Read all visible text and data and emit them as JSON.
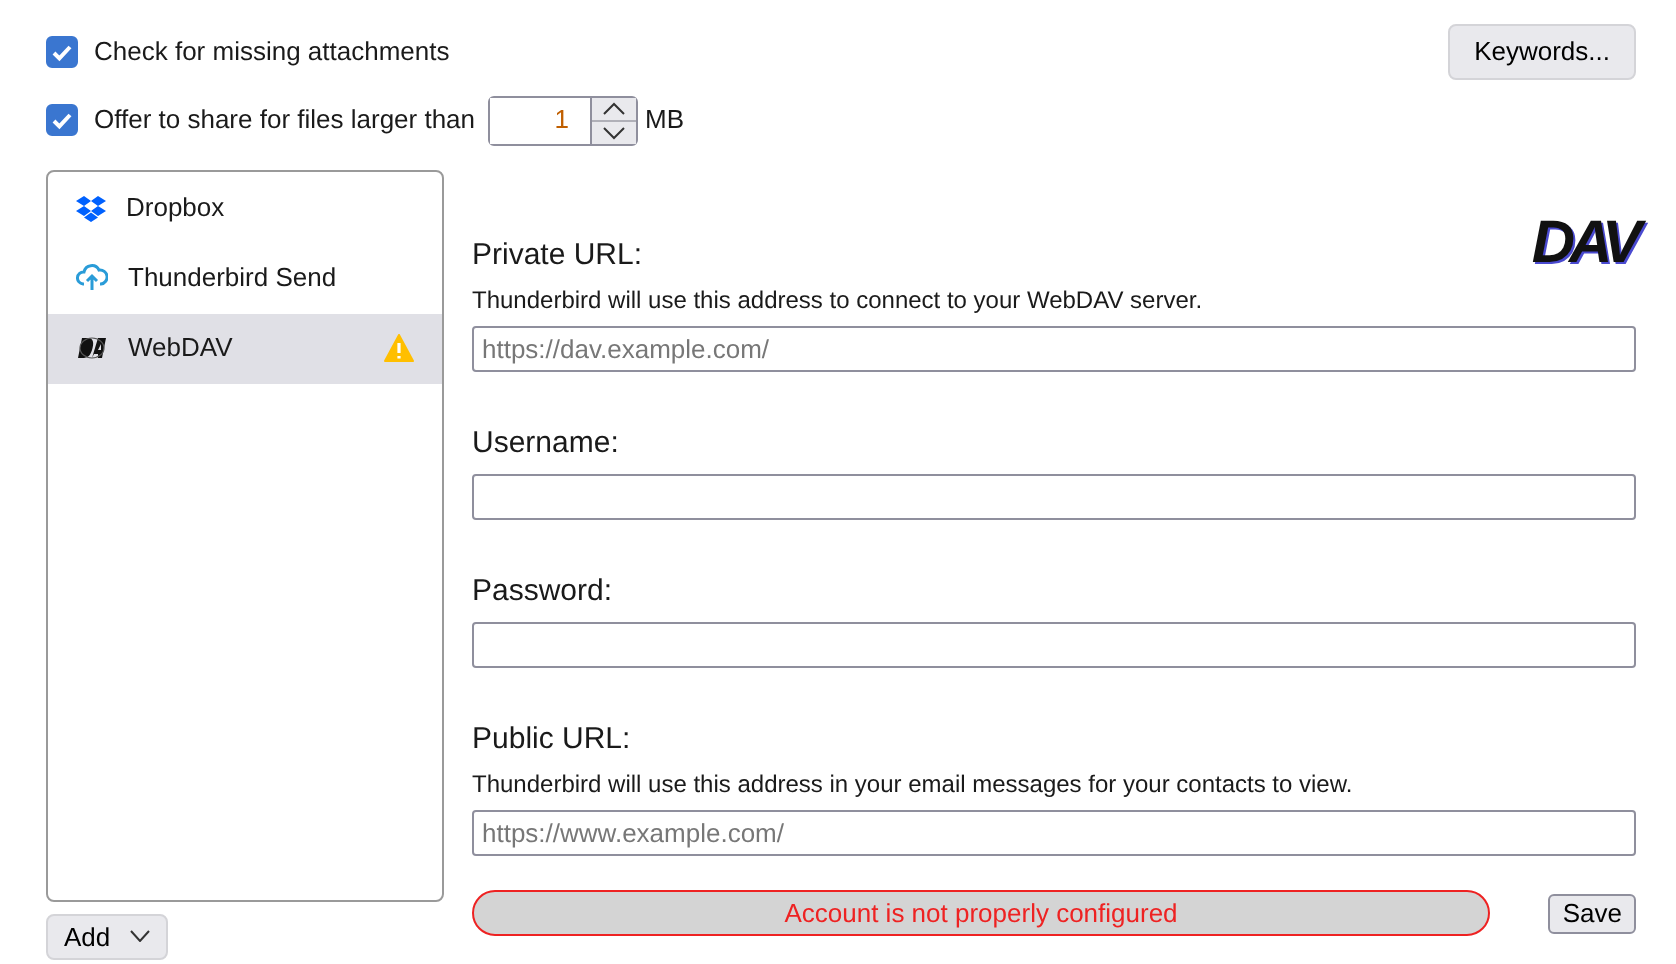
{
  "options": [
    {
      "label": "Check for missing attachments",
      "checked": true
    },
    {
      "label": "Offer to share for files larger than",
      "checked": true,
      "value": "1",
      "unit": "MB"
    }
  ],
  "keywords_button": "Keywords...",
  "providers": [
    {
      "name": "Dropbox",
      "selected": false,
      "warning": false
    },
    {
      "name": "Thunderbird Send",
      "selected": false,
      "warning": false
    },
    {
      "name": "WebDAV",
      "selected": true,
      "warning": true
    }
  ],
  "add_button": "Add",
  "form": {
    "logo": "DAV",
    "fields": [
      {
        "label": "Private URL:",
        "description": "Thunderbird will use this address to connect to your WebDAV server.",
        "placeholder": "https://dav.example.com/"
      },
      {
        "label": "Username:"
      },
      {
        "label": "Password:"
      },
      {
        "label": "Public URL:",
        "description": "Thunderbird will use this address in your email messages for your contacts to view.",
        "placeholder": "https://www.example.com/"
      }
    ],
    "status": "Account is not properly configured",
    "save_button": "Save"
  }
}
